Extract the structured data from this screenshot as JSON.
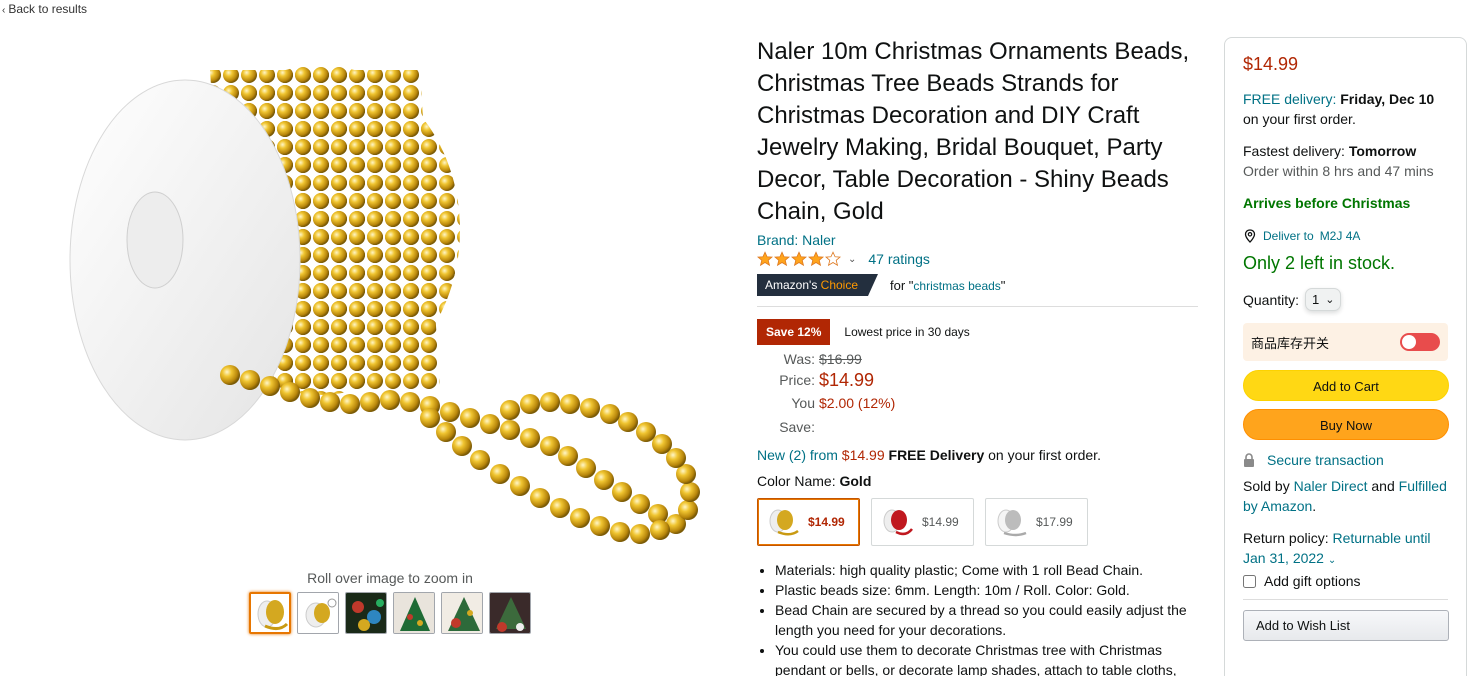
{
  "nav": {
    "back_label": "Back to results"
  },
  "gallery": {
    "zoom_hint": "Roll over image to zoom in",
    "thumbnail_count": 6
  },
  "product": {
    "title": "Naler 10m Christmas Ornaments Beads, Christmas Tree Beads Strands for Christmas Decoration and DIY Craft Jewelry Making, Bridal Bouquet, Party Decor, Table Decoration - Shiny Beads Chain, Gold",
    "brand": "Brand: Naler",
    "rating_stars": 4.1,
    "ratings_count": "47 ratings",
    "choice_badge_prefix": "Amazon's",
    "choice_badge_suffix": "Choice",
    "choice_for": "for \"",
    "choice_keyword": "christmas beads",
    "choice_close": "\""
  },
  "pricing": {
    "save_badge": "Save 12%",
    "lowest": "Lowest price in 30 days",
    "was_label": "Was:",
    "was_value": "$16.99",
    "price_label": "Price:",
    "price_value": "$14.99",
    "save_label": "You Save:",
    "save_value": "$2.00 (12%)",
    "new_link": "New (2) from",
    "new_price": "$14.99",
    "new_free": "FREE Delivery",
    "new_tail": "on your first order."
  },
  "color": {
    "label": "Color Name:",
    "selected": "Gold",
    "options": [
      {
        "name": "Gold",
        "price": "$14.99"
      },
      {
        "name": "Red",
        "price": "$14.99"
      },
      {
        "name": "Silver",
        "price": "$17.99"
      }
    ]
  },
  "bullets": [
    "Materials: high quality plastic; Come with 1 roll Bead Chain.",
    "Plastic beads size: 6mm. Length: 10m / Roll. Color: Gold.",
    "Bead Chain are secured by a thread so you could easily adjust the length you need for your decorations.",
    "You could use them to decorate Christmas tree with Christmas pendant or bells, or decorate lamp shades, attach to table cloths, create your own chandeliers and so much more."
  ],
  "buybox": {
    "price": "$14.99",
    "free_delivery_label": "FREE delivery:",
    "free_delivery_date": "Friday, Dec 10",
    "free_delivery_tail": "on your first order.",
    "fastest_label": "Fastest delivery:",
    "fastest_value": "Tomorrow",
    "order_within": "Order within 8 hrs and 47 mins",
    "arrives": "Arrives before Christmas",
    "deliver_to": "Deliver to",
    "postcode": "M2J 4A",
    "stock": "Only 2 left in stock.",
    "quantity_label": "Quantity:",
    "quantity_value": "1",
    "toggle_label": "商品库存开关",
    "add_to_cart": "Add to Cart",
    "buy_now": "Buy Now",
    "secure": "Secure transaction",
    "sold_by_label": "Sold by",
    "seller": "Naler Direct",
    "and": "and",
    "fulfilled": "Fulfilled by Amazon",
    "period": ".",
    "return_label": "Return policy:",
    "return_value": "Returnable until Jan 31, 2022",
    "gift": "Add gift options",
    "wish": "Add to Wish List"
  },
  "colors": {
    "price_red": "#b12704",
    "link_teal": "#007185",
    "stock_green": "#007600",
    "cart_yellow": "#ffd814",
    "buy_orange": "#ffa41c",
    "star_orange": "#ffa41c"
  }
}
